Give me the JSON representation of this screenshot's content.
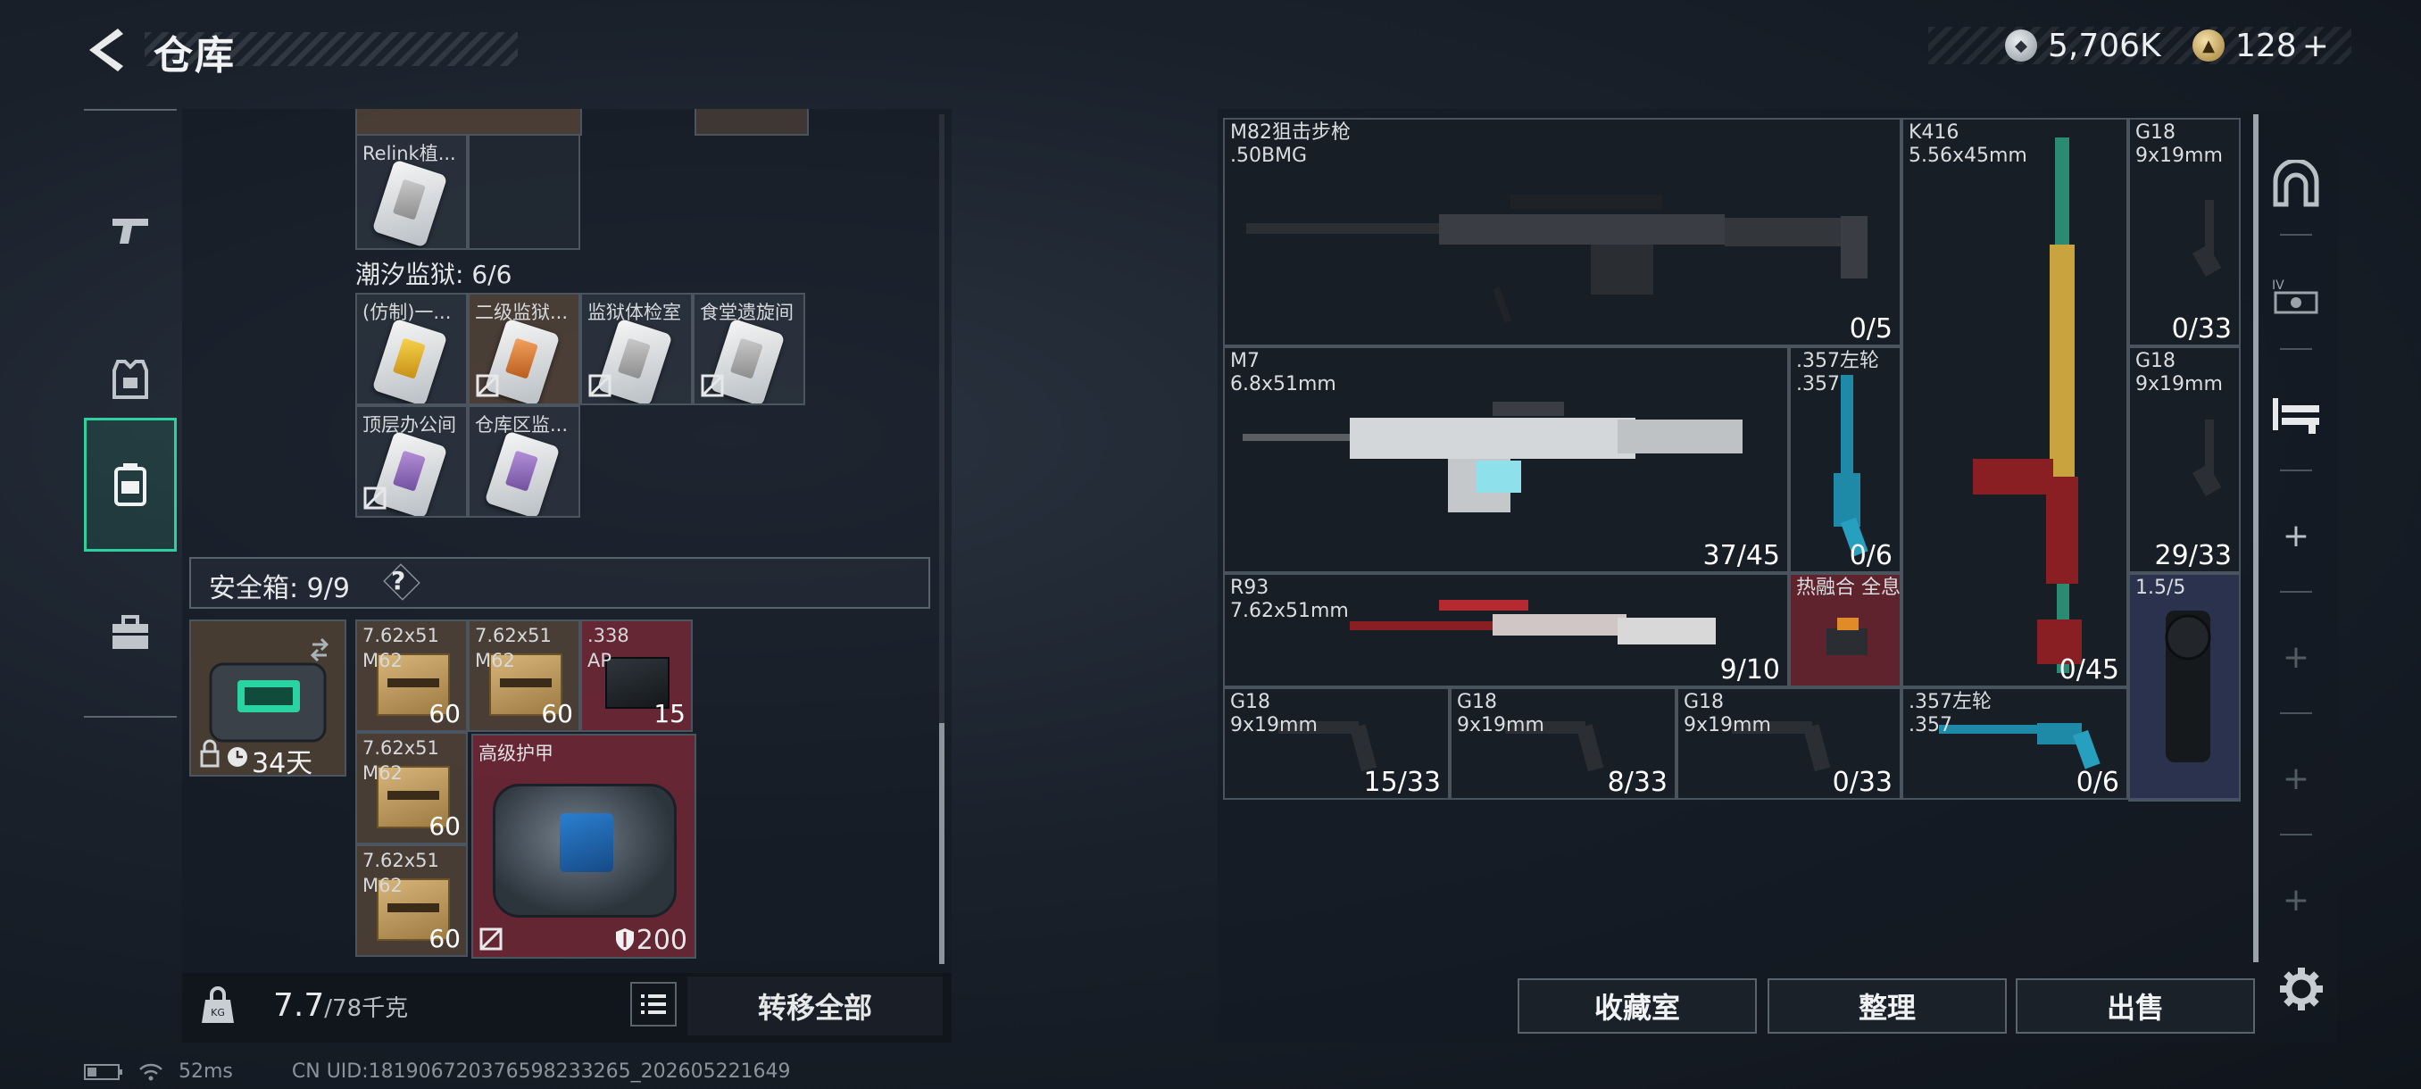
{
  "header": {
    "title": "仓库"
  },
  "currency": {
    "silver": "5,706K",
    "gold": "128",
    "gold_plus": "+"
  },
  "nav": {
    "items": [
      "weapons",
      "armor",
      "backpack",
      "case"
    ]
  },
  "left": {
    "top_row": [
      {
        "name": "Relink植..."
      }
    ],
    "prison_title": "潮汐监狱: 6/6",
    "prison_keys": [
      {
        "name": "(仿制)一...",
        "color": "yellow"
      },
      {
        "name": "二级监狱...",
        "color": "orange"
      },
      {
        "name": "监狱体检室",
        "color": "gray"
      },
      {
        "name": "食堂遗旋间",
        "color": "gray"
      },
      {
        "name": "顶层办公间",
        "color": "purple"
      },
      {
        "name": "仓库区监...",
        "color": "purple"
      }
    ],
    "safe_label": "安全箱: 9/9",
    "safe_help": "?",
    "safebox": {
      "days": "34天"
    },
    "safe_items": [
      {
        "name": "7.62x51",
        "sub": "M62",
        "qty": "60"
      },
      {
        "name": "7.62x51",
        "sub": "M62",
        "qty": "60"
      },
      {
        "name": ".338",
        "sub": "AP",
        "qty": "15"
      },
      {
        "name": "7.62x51",
        "sub": "M62",
        "qty": "60"
      },
      {
        "name": "7.62x51",
        "sub": "M62",
        "qty": "60"
      }
    ],
    "armor": {
      "name": "高级护甲",
      "durability": "200"
    },
    "weight": {
      "value": "7.7",
      "cap": "/78千克"
    },
    "transfer_all": "转移全部"
  },
  "status": {
    "ping": "52ms",
    "uid": "CN UID:1819067203765982332​65_202605221649"
  },
  "right": {
    "cells": [
      {
        "id": "m82",
        "name": "M82狙击步枪",
        "ammo": ".50BMG",
        "count": "0/5"
      },
      {
        "id": "k416",
        "name": "K416",
        "ammo": "5.56x45mm",
        "count": "0/45"
      },
      {
        "id": "g18a",
        "name": "G18",
        "ammo": "9x19mm",
        "count": "0/33"
      },
      {
        "id": "m7",
        "name": "M7",
        "ammo": "6.8x51mm",
        "count": "37/45"
      },
      {
        "id": "rev1",
        "name": ".357左轮",
        "ammo": ".357",
        "count": "0/6"
      },
      {
        "id": "g18b",
        "name": "G18",
        "ammo": "9x19mm",
        "count": "29/33"
      },
      {
        "id": "r93",
        "name": "R93",
        "ammo": "7.62x51mm",
        "count": "9/10"
      },
      {
        "id": "scope",
        "name": "热融合 全息",
        "ammo": "",
        "count": ""
      },
      {
        "id": "scope2",
        "name": "1.5/5",
        "ammo": "",
        "count": ""
      },
      {
        "id": "g18c",
        "name": "G18",
        "ammo": "9x19mm",
        "count": "15/33"
      },
      {
        "id": "g18d",
        "name": "G18",
        "ammo": "9x19mm",
        "count": "8/33"
      },
      {
        "id": "g18e",
        "name": "G18",
        "ammo": "9x19mm",
        "count": "0/33"
      },
      {
        "id": "rev2",
        "name": ".357左轮",
        "ammo": ".357",
        "count": "0/6"
      }
    ],
    "side": {
      "add": "+"
    },
    "buttons": {
      "collection": "收藏室",
      "organize": "整理",
      "sell": "出售"
    }
  },
  "colors": {
    "accent": "#2fd0a0",
    "red_slot": "#802a38",
    "panel": "#141a22"
  }
}
